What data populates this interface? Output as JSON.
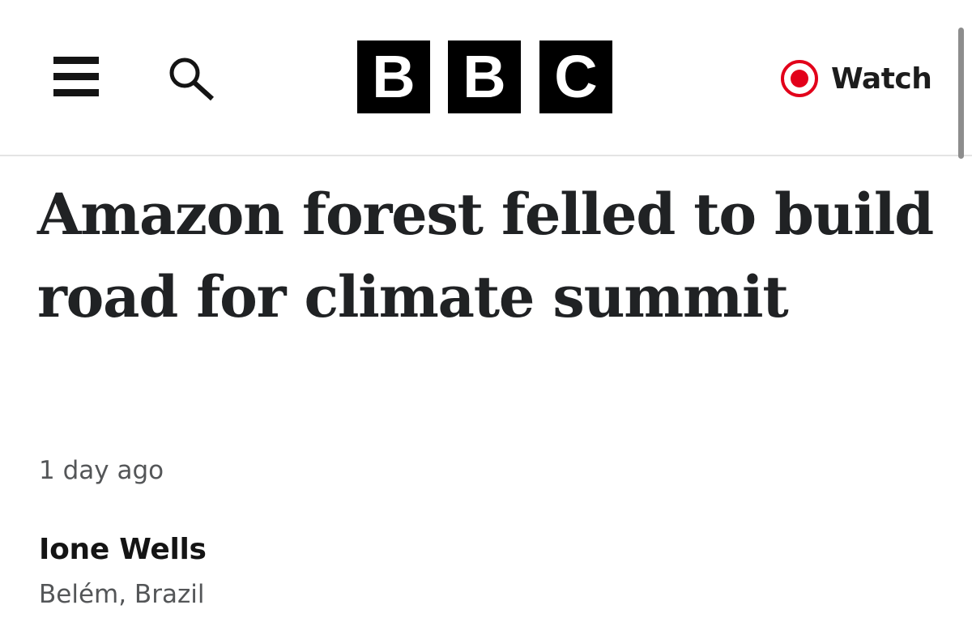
{
  "header": {
    "logo_letters": [
      "B",
      "B",
      "C"
    ],
    "menu_icon": "hamburger-menu-icon",
    "search_icon": "search-icon",
    "watch_label": "Watch",
    "watch_icon": "live-record-icon",
    "accent_color": "#e2001a"
  },
  "article": {
    "headline": "Amazon forest felled to build road for climate summit",
    "timestamp": "1 day ago",
    "author": "Ione Wells",
    "location": "Belém, Brazil"
  }
}
